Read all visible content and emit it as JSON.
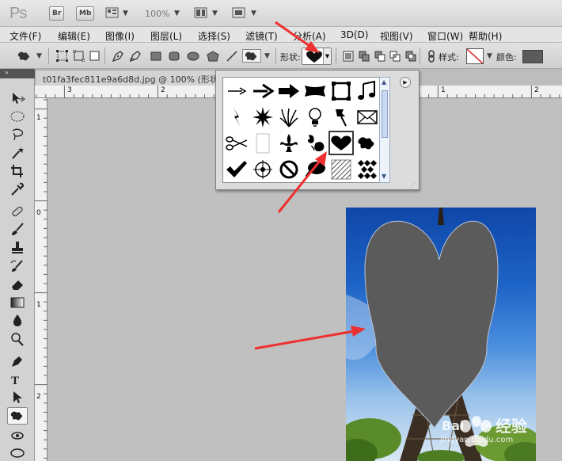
{
  "app": {
    "logo": "Ps",
    "bridge_button": "Br",
    "minibridge_button": "Mb",
    "zoom": "100%"
  },
  "menu": [
    "文件(F)",
    "编辑(E)",
    "图像(I)",
    "图层(L)",
    "选择(S)",
    "滤镜(T)",
    "分析(A)",
    "3D(D)",
    "视图(V)",
    "窗口(W)",
    "帮助(H)"
  ],
  "options": {
    "shape_label": "形状:",
    "style_label": "样式:",
    "color_label": "颜色:",
    "fill_color": "#5b5b5b",
    "selected_shape": "heart-icon"
  },
  "document": {
    "tab_title": "t01fa3fec811e9a6d8d.jpg @ 100% (形状",
    "ruler_top": [
      "3",
      "2",
      "1",
      "0",
      "1",
      "2"
    ],
    "ruler_left": [
      "1",
      "0",
      "1",
      "2"
    ]
  },
  "shape_picker": {
    "shapes": [
      "thin-arrow-icon",
      "arrow-icon",
      "bold-arrow-icon",
      "banner-icon",
      "square-frame-icon",
      "music-note-icon",
      "lightning-icon",
      "starburst-icon",
      "grass-icon",
      "lightbulb-icon",
      "pushpin-icon",
      "envelope-icon",
      "scissors-icon",
      "blank-page-icon",
      "fleur-de-lis-icon",
      "ornament-icon",
      "heart-icon",
      "puzzle-icon",
      "checkmark-icon",
      "target-icon",
      "no-sign-icon",
      "speech-bubble-icon",
      "hatch-pattern-icon",
      "diamond-grid-icon"
    ]
  },
  "watermark": {
    "brand": "Bai",
    "brand_cn": "经验",
    "url": "jingyan.baidu.com"
  }
}
